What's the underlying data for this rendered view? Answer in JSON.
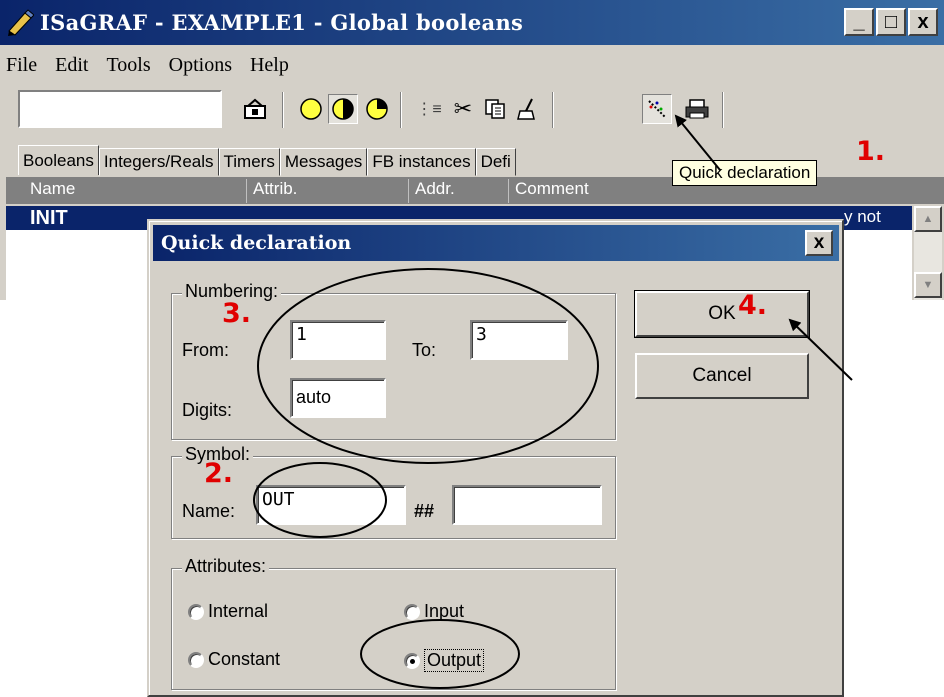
{
  "app": {
    "title": "ISaGRAF - EXAMPLE1 - Global booleans",
    "window_controls": {
      "minimize": "_",
      "maximize": "□",
      "close": "x"
    }
  },
  "menu": {
    "items": [
      "File",
      "Edit",
      "Tools",
      "Options",
      "Help"
    ]
  },
  "toolbar": {
    "field_value": "",
    "icons": [
      "open-icon",
      "yellow-circle-icon",
      "half-circle-icon",
      "pie-icon",
      "declare-icon",
      "cut-icon",
      "copy-icon",
      "broom-icon",
      "quick-declaration-icon",
      "print-icon"
    ]
  },
  "tabs": [
    "Booleans",
    "Integers/Reals",
    "Timers",
    "Messages",
    "FB instances",
    "Defi"
  ],
  "tooltip": "Quick declaration",
  "grid": {
    "columns": [
      "Name",
      "Attrib.",
      "Addr.",
      "Comment"
    ],
    "selected_row": {
      "name": "INIT",
      "comment_tail": "y not"
    }
  },
  "dialog": {
    "title": "Quick declaration",
    "close_label": "x",
    "numbering": {
      "label": "Numbering:",
      "from_label": "From:",
      "from_value": "1",
      "to_label": "To:",
      "to_value": "3",
      "digits_label": "Digits:",
      "digits_value": "auto"
    },
    "symbol": {
      "label": "Symbol:",
      "name_label": "Name:",
      "name_value": "OUT",
      "sep_label": "##",
      "suffix_value": ""
    },
    "attributes": {
      "label": "Attributes:",
      "internal": "Internal",
      "input": "Input",
      "constant": "Constant",
      "output": "Output",
      "selected": "Output"
    },
    "ok_label": "OK",
    "cancel_label": "Cancel"
  },
  "annotations": {
    "step1": "1.",
    "step2": "2.",
    "step3": "3.",
    "step4": "4.",
    "color": "#e00000"
  },
  "colors": {
    "title_bar": "#0a246a",
    "face": "#d4d0c8",
    "selection": "#0a246a",
    "tooltip_bg": "#ffffe1"
  }
}
